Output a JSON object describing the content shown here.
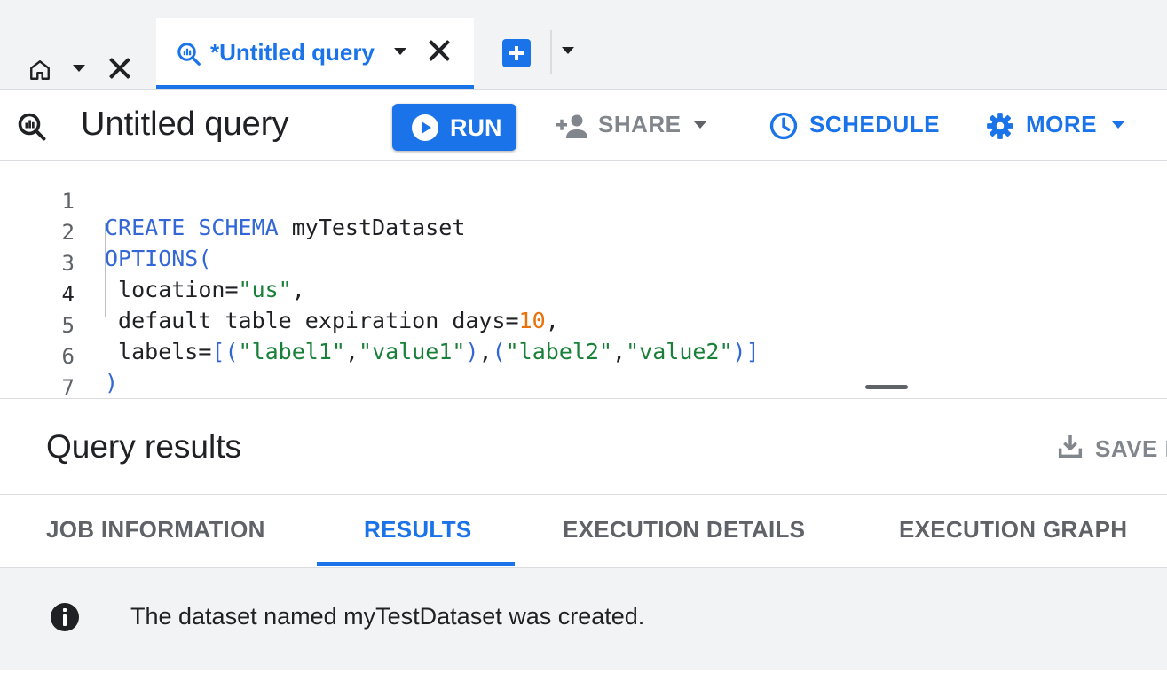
{
  "tabs": {
    "home": {
      "icon": "home-icon"
    },
    "active": {
      "label": "*Untitled query",
      "icon": "query-icon"
    }
  },
  "toolbar": {
    "title": "Untitled query",
    "run_label": "RUN",
    "share_label": "SHARE",
    "schedule_label": "SCHEDULE",
    "more_label": "MORE",
    "accent_color": "#1a73e8"
  },
  "editor": {
    "lines": [
      {
        "n": "1",
        "text": "CREATE SCHEMA myTestDataset"
      },
      {
        "n": "2",
        "text": "OPTIONS("
      },
      {
        "n": "3",
        "text": "location=\"us\","
      },
      {
        "n": "4",
        "text": "default_table_expiration_days=10,"
      },
      {
        "n": "5",
        "text": "labels=[(\"label1\",\"value1\"),(\"label2\",\"value2\")]"
      },
      {
        "n": "6",
        "text": ")"
      },
      {
        "n": "7",
        "text": ""
      }
    ]
  },
  "results": {
    "title": "Query results",
    "save_label": "SAVE I",
    "tabs": [
      {
        "label": "JOB INFORMATION"
      },
      {
        "label": "RESULTS",
        "active": true
      },
      {
        "label": "EXECUTION DETAILS"
      },
      {
        "label": "EXECUTION GRAPH"
      }
    ],
    "message": "The dataset named myTestDataset was created."
  }
}
